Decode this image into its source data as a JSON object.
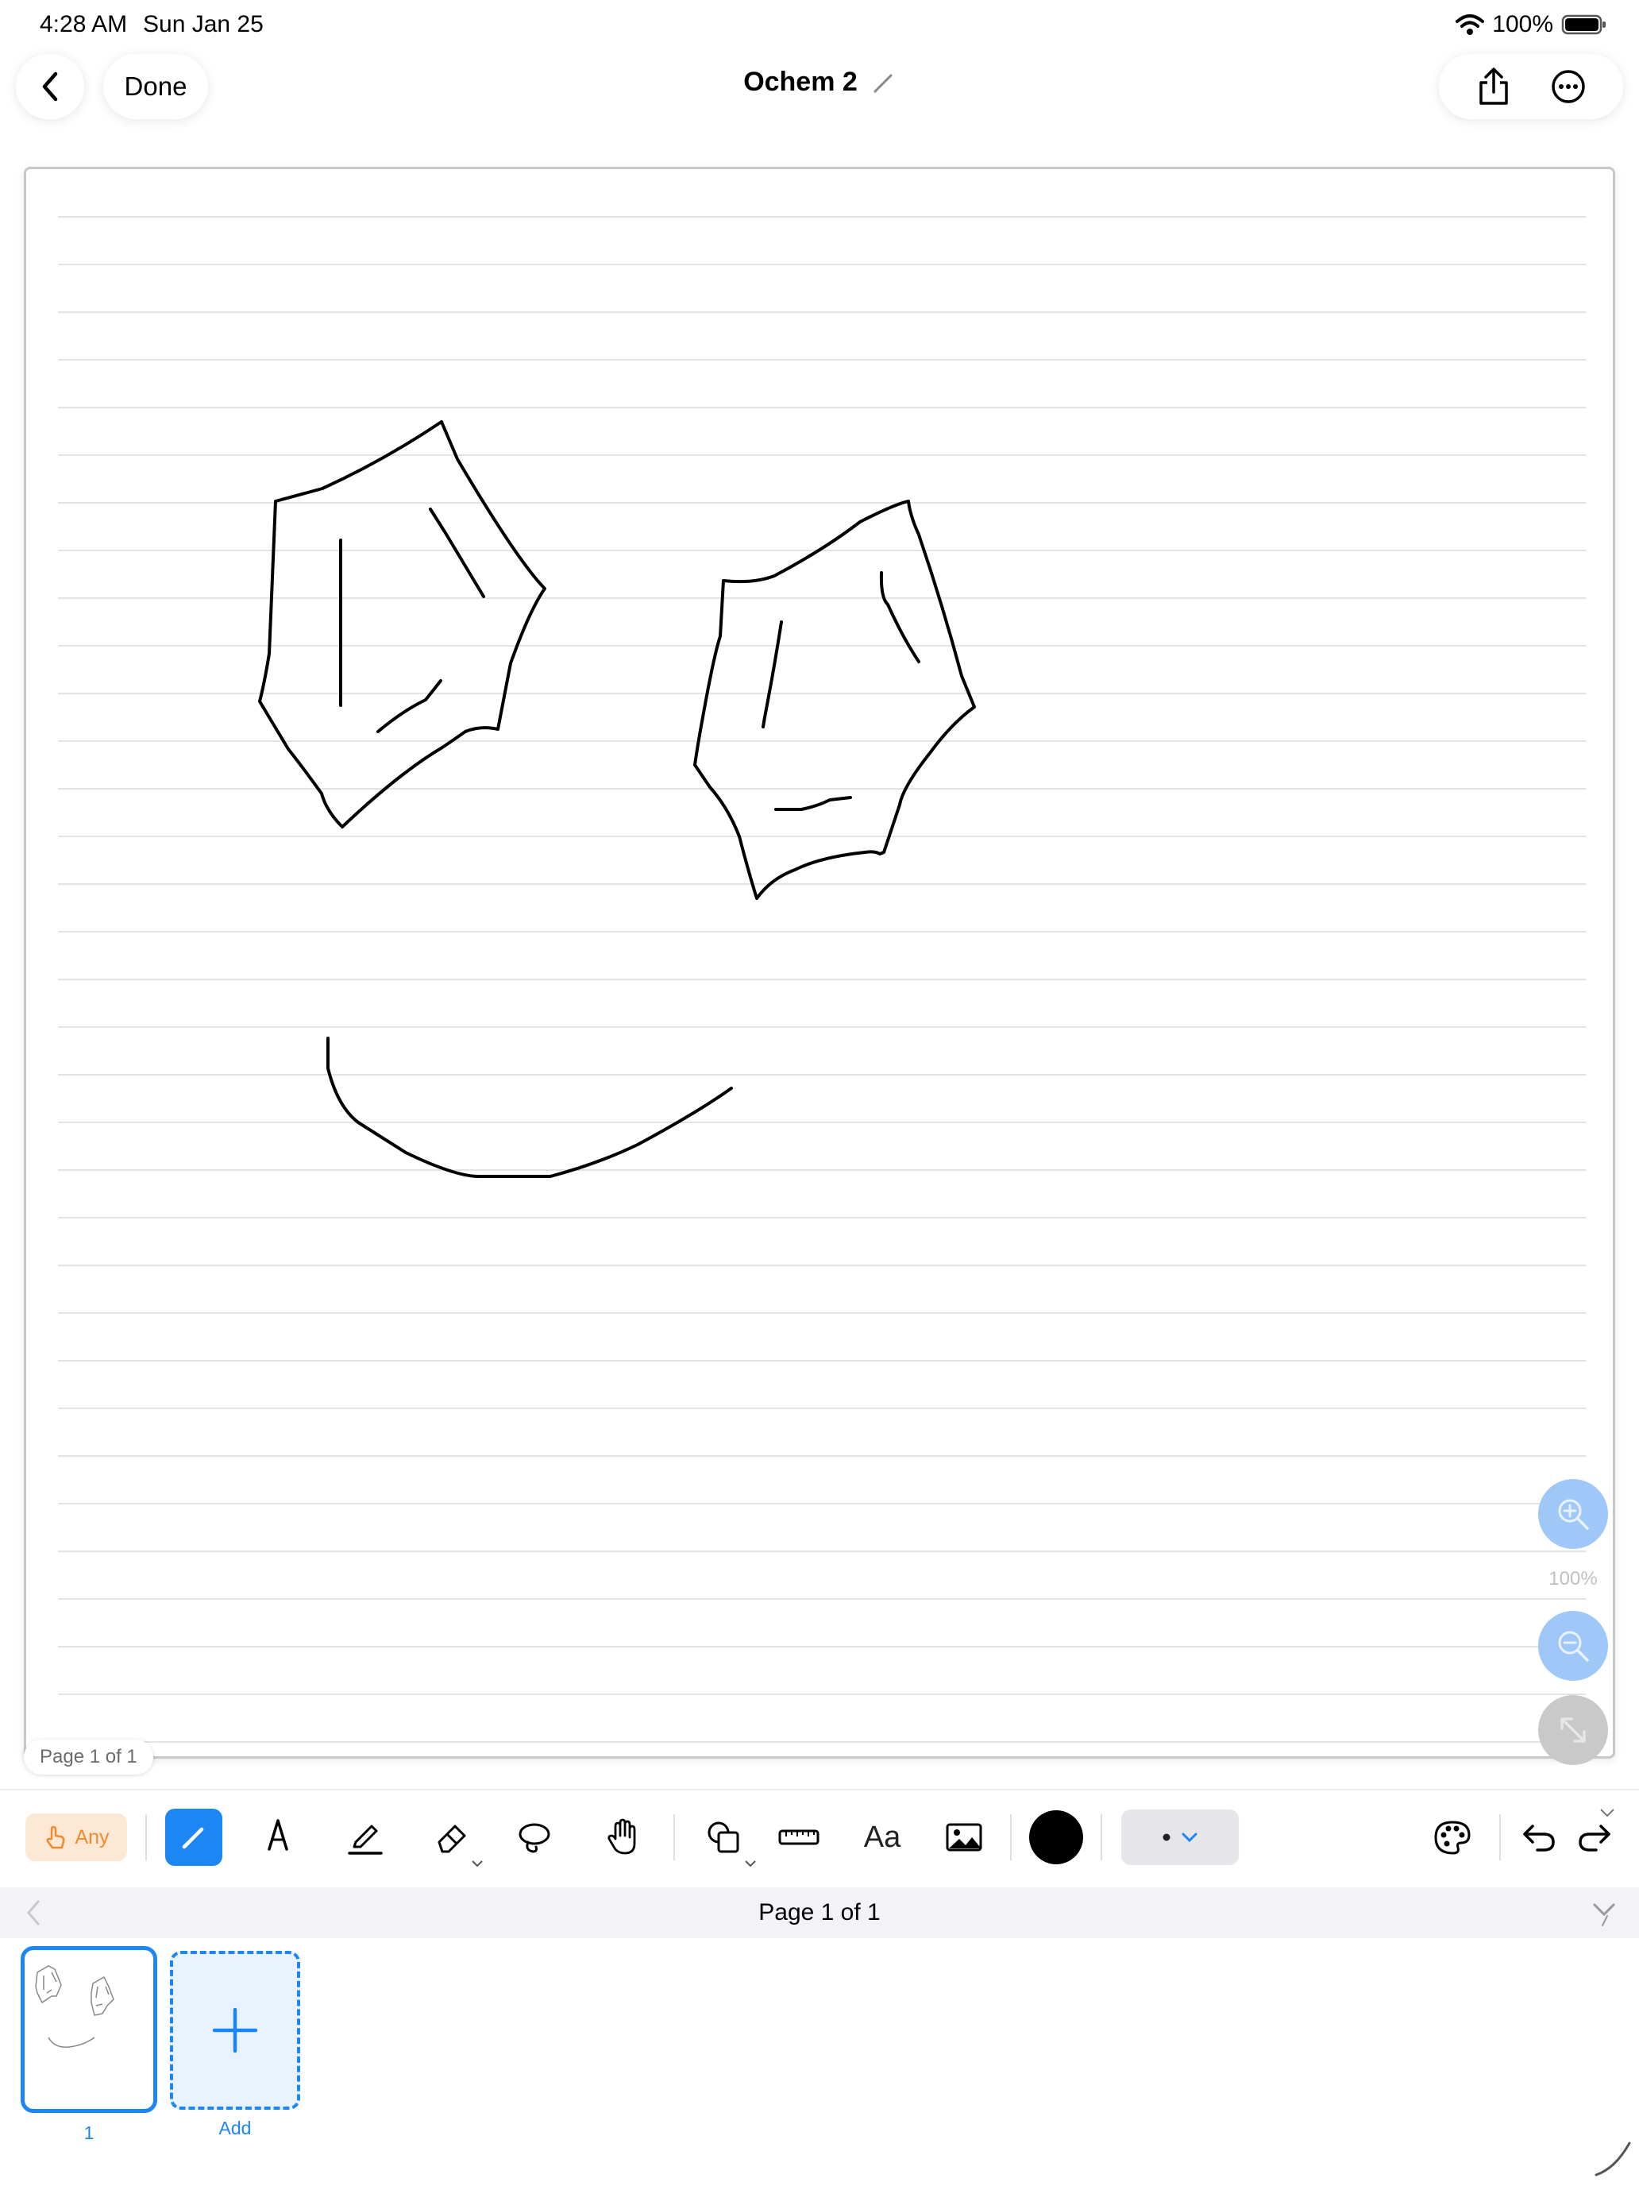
{
  "status_bar": {
    "time": "4:28 AM",
    "date": "Sun Jan 25",
    "battery": "100%"
  },
  "nav": {
    "done_label": "Done",
    "document_title": "Ochem 2"
  },
  "canvas": {
    "page_badge": "Page 1 of 1",
    "zoom_level": "100%"
  },
  "toolbar": {
    "input_mode_label": "Any",
    "tools": [
      "pen",
      "fountain-pen",
      "highlighter",
      "eraser",
      "lasso",
      "hand",
      "shapes",
      "ruler",
      "text",
      "image"
    ],
    "text_tool_label": "Aa",
    "selected_color": "#000000",
    "accent_color": "#1d86f5"
  },
  "page_strip": {
    "label": "Page 1 of 1",
    "thumbnail_number": "1",
    "add_label": "Add"
  }
}
